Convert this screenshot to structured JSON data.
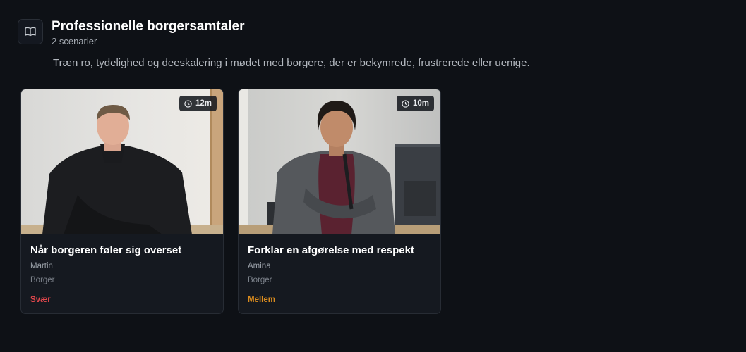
{
  "section": {
    "title": "Professionelle borgersamtaler",
    "count": "2 scenarier",
    "description": "Træn ro, tydelighed og deeskalering i mødet med borgere, der er bekymrede, frustrerede eller uenige.",
    "icon": "book-icon"
  },
  "scenarios": [
    {
      "title": "Når borgeren føler sig overset",
      "person": "Martin",
      "role": "Borger",
      "difficulty": "Svær",
      "difficulty_color": "#e5484d",
      "duration": "12m"
    },
    {
      "title": "Forklar en afgørelse med respekt",
      "person": "Amina",
      "role": "Borger",
      "difficulty": "Mellem",
      "difficulty_color": "#d98b1e",
      "duration": "10m"
    }
  ],
  "colors": {
    "background": "#0e1116",
    "card": "#151920",
    "hard": "#e5484d",
    "medium": "#d98b1e"
  }
}
